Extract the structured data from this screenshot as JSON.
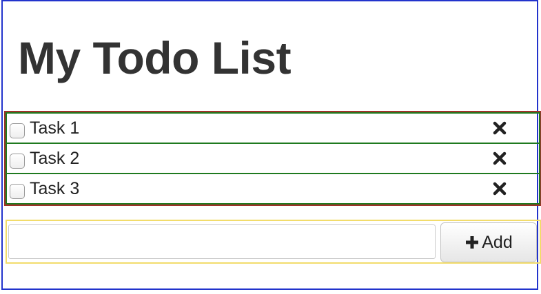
{
  "app": {
    "title": "My Todo List"
  },
  "todos": [
    {
      "label": "Task 1",
      "checked": false
    },
    {
      "label": "Task 2",
      "checked": false
    },
    {
      "label": "Task 3",
      "checked": false
    }
  ],
  "icons": {
    "delete": "close-icon",
    "add": "plus-icon"
  },
  "form": {
    "input_value": "",
    "input_placeholder": "",
    "add_label": "Add"
  },
  "colors": {
    "app_border": "#2233cc",
    "list_border": "#a0322a",
    "item_border": "#1f7a1f",
    "form_border": "#f2dc6b",
    "title_text": "#333333"
  }
}
